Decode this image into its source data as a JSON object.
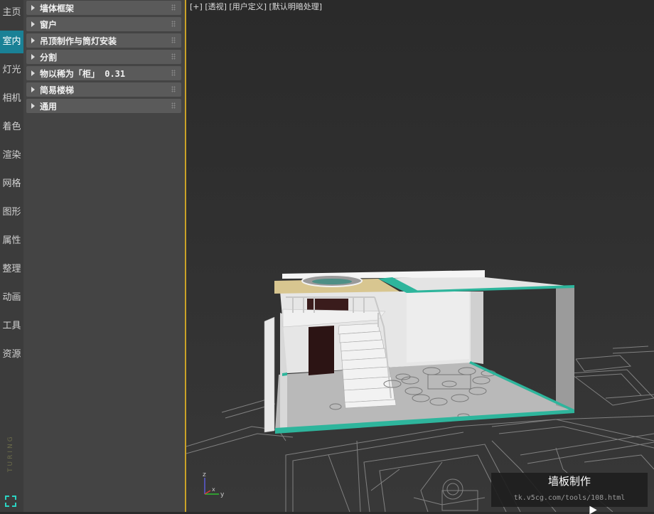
{
  "sidebar": {
    "items": [
      {
        "label": "主页"
      },
      {
        "label": "室内",
        "active": true
      },
      {
        "label": "灯光"
      },
      {
        "label": "相机"
      },
      {
        "label": "着色"
      },
      {
        "label": "渲染"
      },
      {
        "label": "网格"
      },
      {
        "label": "图形"
      },
      {
        "label": "属性"
      },
      {
        "label": "整理"
      },
      {
        "label": "动画"
      },
      {
        "label": "工具"
      },
      {
        "label": "资源"
      }
    ],
    "brand": "TURING",
    "accent_color": "#1a8196"
  },
  "panel": {
    "rollouts": [
      {
        "label": "墙体框架"
      },
      {
        "label": "窗户"
      },
      {
        "label": "吊顶制作与筒灯安装"
      },
      {
        "label": "分割"
      },
      {
        "label": "物以稀为「柜」 0.31"
      },
      {
        "label": "简易楼梯"
      },
      {
        "label": "通用"
      }
    ]
  },
  "viewport": {
    "label_plus": "[+]",
    "label_view": "[透视]",
    "label_user": "[用户定义]",
    "label_shading": "[默认明暗处理]",
    "axis_z": "z",
    "axis_y": "y",
    "axis_x": "x",
    "active_border_color": "#caa227"
  },
  "watermark": {
    "title": "墙板制作",
    "url": "tk.v5cg.com/tools/108.html"
  }
}
